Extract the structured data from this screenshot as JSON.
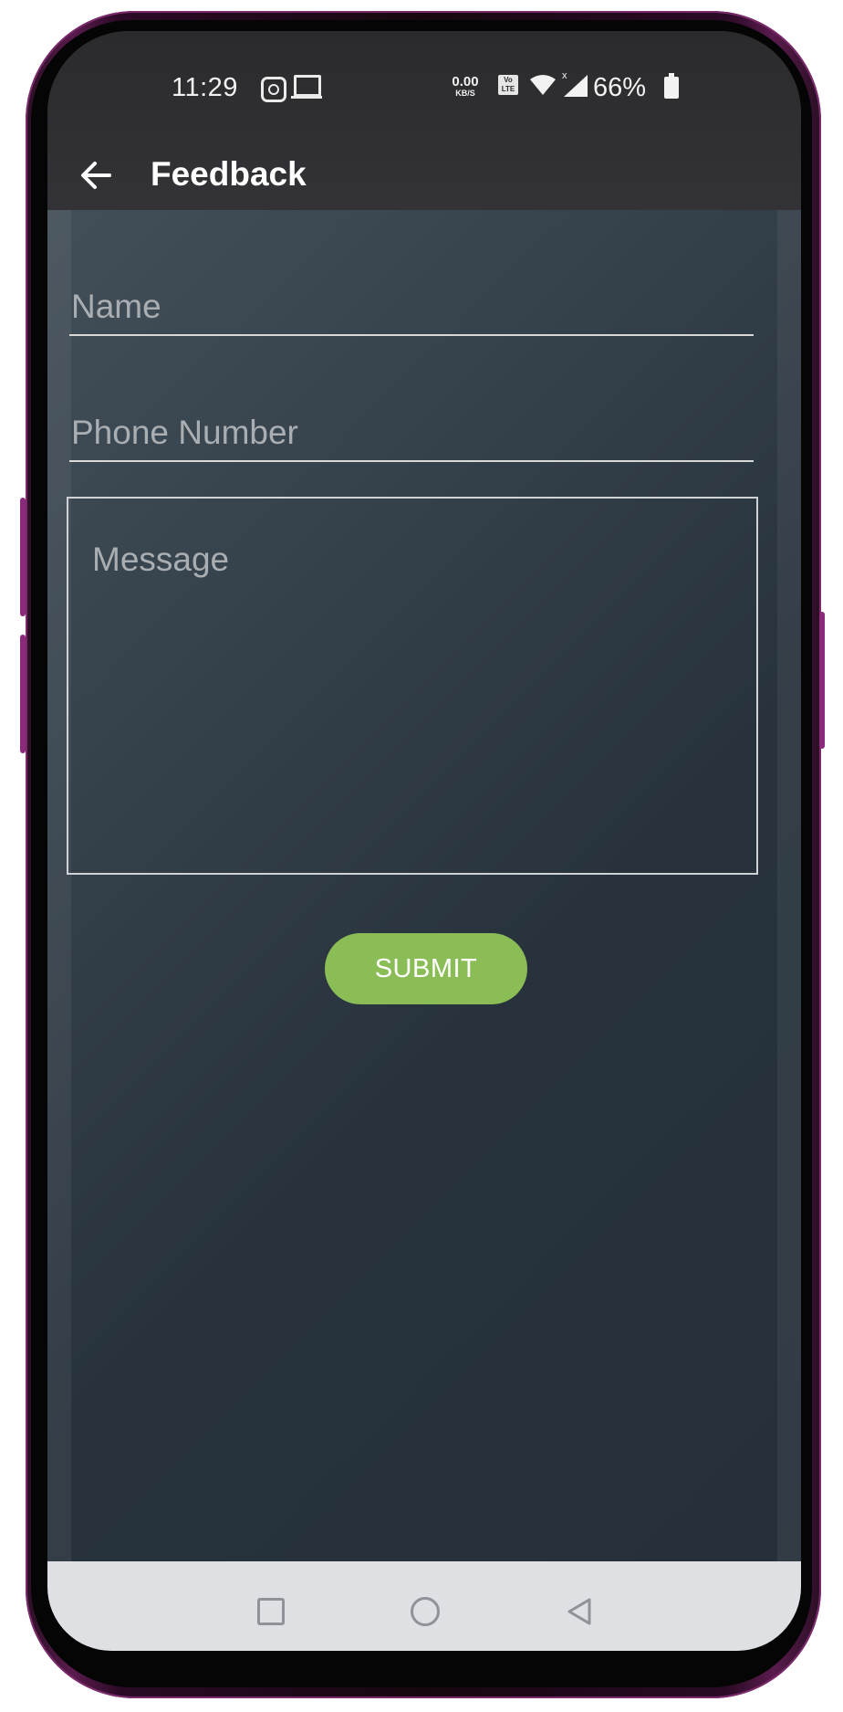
{
  "status_bar": {
    "time": "11:29",
    "speed_value": "0.00",
    "speed_unit": "KB/S",
    "volte_label": "Vo LTE",
    "battery_percent": "66%",
    "icons": [
      "instagram-icon",
      "laptop-icon",
      "volte-icon",
      "wifi-icon",
      "signal-icon",
      "battery-icon"
    ]
  },
  "toolbar": {
    "title": "Feedback",
    "back_icon": "arrow-left-icon"
  },
  "form": {
    "name_placeholder": "Name",
    "name_value": "",
    "phone_placeholder": "Phone Number",
    "phone_value": "",
    "message_placeholder": "Message",
    "message_value": "",
    "submit_label": "SUBMIT"
  },
  "nav_bar": {
    "icons": [
      "recent-apps-icon",
      "home-icon",
      "back-triangle-icon"
    ]
  },
  "colors": {
    "header_bg": "#2b2b2d",
    "screen_bg": "#2f3a44",
    "submit_bg": "#8bbd57",
    "nav_bg": "#dfe0e4",
    "frame": "#5a1b4d"
  }
}
